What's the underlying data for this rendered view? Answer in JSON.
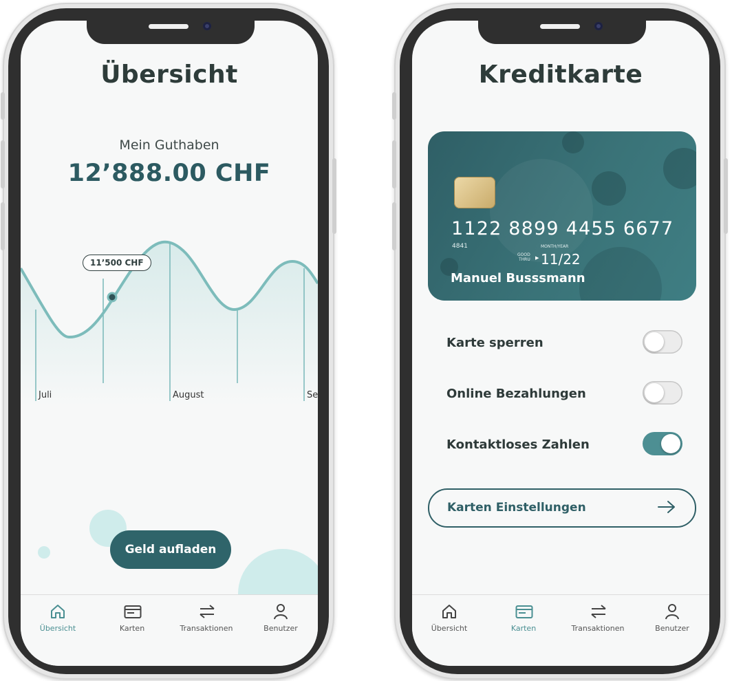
{
  "overview_screen": {
    "title": "Übersicht",
    "balance_label": "Mein Guthaben",
    "balance_value": "12’888.00 CHF",
    "chart_tooltip": "11’500 CHF",
    "chart_months": [
      "Juli",
      "August",
      "Se"
    ],
    "primary_action": "Geld aufladen"
  },
  "card_screen": {
    "title": "Kreditkarte",
    "card": {
      "number": "1122  8899 4455  6677",
      "number_sub": "4841",
      "expiry_label": "MONTH/YEAR",
      "good_thru_1": "GOOD",
      "good_thru_2": "THRU",
      "expiry": "11/22",
      "holder": "Manuel Busssmann"
    },
    "settings": [
      {
        "label": "Karte sperren",
        "enabled": false
      },
      {
        "label": "Online Bezahlungen",
        "enabled": false
      },
      {
        "label": "Kontaktloses Zahlen",
        "enabled": true
      }
    ],
    "settings_button": "Karten Einstellungen"
  },
  "tabbar": {
    "items": [
      {
        "label": "Übersicht",
        "icon": "home-icon"
      },
      {
        "label": "Karten",
        "icon": "card-icon"
      },
      {
        "label": "Transaktionen",
        "icon": "transfer-icon"
      },
      {
        "label": "Benutzer",
        "icon": "user-icon"
      }
    ],
    "active_left": "Übersicht",
    "active_right": "Karten"
  },
  "colors": {
    "primary": "#2f646a",
    "accent": "#4a8f92",
    "chart_line": "#7dbcbb",
    "background": "#f7f8f8"
  }
}
